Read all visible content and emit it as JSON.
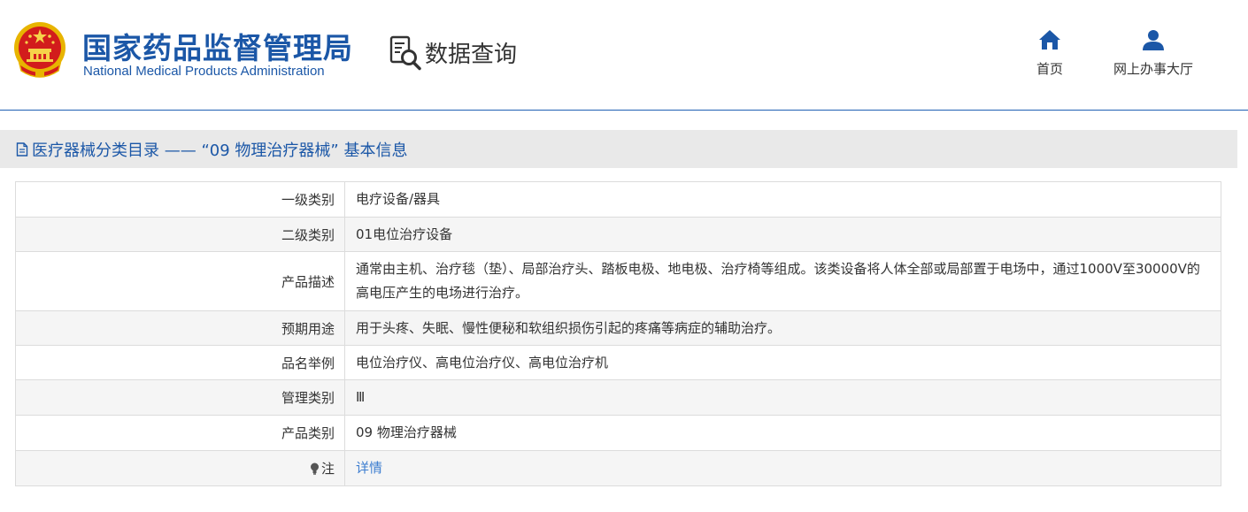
{
  "header": {
    "brand_cn": "国家药品监督管理局",
    "brand_en": "National Medical Products Administration",
    "query_label": "数据查询",
    "nav": [
      {
        "label": "首页",
        "icon": "home-icon"
      },
      {
        "label": "网上办事大厅",
        "icon": "user-icon"
      }
    ]
  },
  "section": {
    "title": "医疗器械分类目录 —— “09 物理治疗器械” 基本信息",
    "icon": "document-icon"
  },
  "table": {
    "rows": [
      {
        "label": "一级类别",
        "value": "电疗设备/器具"
      },
      {
        "label": "二级类别",
        "value": "01电位治疗设备"
      },
      {
        "label": "产品描述",
        "value": "通常由主机、治疗毯（垫）、局部治疗头、踏板电极、地电极、治疗椅等组成。该类设备将人体全部或局部置于电场中，通过1000V至30000V的高电压产生的电场进行治疗。"
      },
      {
        "label": "预期用途",
        "value": "用于头疼、失眠、慢性便秘和软组织损伤引起的疼痛等病症的辅助治疗。"
      },
      {
        "label": "品名举例",
        "value": "电位治疗仪、高电位治疗仪、高电位治疗机"
      },
      {
        "label": "管理类别",
        "value": "Ⅲ"
      },
      {
        "label": "产品类别",
        "value": "09 物理治疗器械"
      },
      {
        "label": "注",
        "value": "详情",
        "icon": "lightbulb-icon"
      }
    ]
  },
  "colors": {
    "brand_blue": "#1b57a7",
    "link_blue": "#3c7dd0",
    "section_bg": "#e9e9e9",
    "row_alt": "#f5f5f5"
  }
}
